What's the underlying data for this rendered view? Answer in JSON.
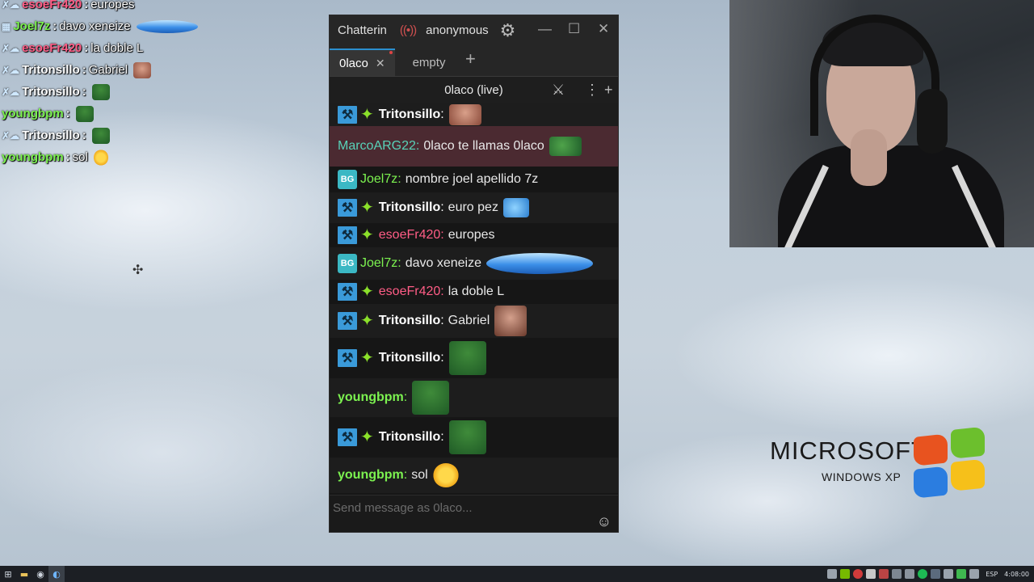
{
  "overlay_chat": [
    {
      "badges": true,
      "user": "esoeFr420",
      "color": "#ff5d86",
      "message": "europes",
      "emote": null
    },
    {
      "badges": false,
      "sub": true,
      "user": "Joel7z",
      "color": "#7cf250",
      "message": "davo xeneize",
      "emote": "ufo"
    },
    {
      "badges": true,
      "user": "esoeFr420",
      "color": "#ff5d86",
      "message": "la doble L",
      "emote": null
    },
    {
      "badges": true,
      "user": "Tritonsillo",
      "color": "#ffffff",
      "message": "Gabriel",
      "emote": "face"
    },
    {
      "badges": true,
      "user": "Tritonsillo",
      "color": "#ffffff",
      "message": "",
      "emote": "frog"
    },
    {
      "badges": false,
      "user": "youngbpm",
      "color": "#7cf250",
      "message": "",
      "emote": "frog"
    },
    {
      "badges": true,
      "user": "Tritonsillo",
      "color": "#ffffff",
      "message": "",
      "emote": "frog"
    },
    {
      "badges": false,
      "user": "youngbpm",
      "color": "#7cf250",
      "message": "sol",
      "emote": "sun"
    }
  ],
  "window": {
    "app_title": "Chatterin",
    "account": "anonymous",
    "tabs": [
      {
        "label": "0laco",
        "active": true
      },
      {
        "label": "empty",
        "active": false
      }
    ],
    "channel_title": "0laco (live)",
    "input_placeholder": "Send message as 0laco..."
  },
  "messages": [
    {
      "badges": "modvip",
      "user": "Tritonsillo",
      "color": "#ffffff",
      "bold": true,
      "text": "",
      "emote": "face",
      "height": 28,
      "style": "alt"
    },
    {
      "badges": "none",
      "user": "MarcoARG22",
      "color": "#58d2b8",
      "bold": false,
      "text": "0laco te llamas 0laco",
      "emote": "pepe-question",
      "height": 50,
      "style": "highlight"
    },
    {
      "badges": "sub",
      "user": "Joel7z",
      "color": "#7cf250",
      "bold": false,
      "text": "nombre joel apellido 7z",
      "emote": null,
      "height": 32,
      "style": ""
    },
    {
      "badges": "modvip",
      "user": "Tritonsillo",
      "color": "#ffffff",
      "bold": true,
      "text": "euro pez",
      "emote": "fish",
      "height": 38,
      "style": "alt"
    },
    {
      "badges": "modvip",
      "user": "esoeFr420",
      "color": "#ff5d86",
      "bold": false,
      "text": "europes",
      "emote": null,
      "height": 30,
      "style": ""
    },
    {
      "badges": "sub",
      "user": "Joel7z",
      "color": "#7cf250",
      "bold": false,
      "text": "davo xeneize",
      "emote": "ufo",
      "height": 40,
      "style": "alt"
    },
    {
      "badges": "modvip",
      "user": "esoeFr420",
      "color": "#ff5d86",
      "bold": false,
      "text": "la doble L",
      "emote": null,
      "height": 30,
      "style": ""
    },
    {
      "badges": "modvip",
      "user": "Tritonsillo",
      "color": "#ffffff",
      "bold": true,
      "text": "Gabriel",
      "emote": "face-big",
      "height": 42,
      "style": "alt"
    },
    {
      "badges": "modvip",
      "user": "Tritonsillo",
      "color": "#ffffff",
      "bold": true,
      "text": "",
      "emote": "frog",
      "height": 50,
      "style": ""
    },
    {
      "badges": "none",
      "user": "youngbpm",
      "color": "#7cf250",
      "bold": true,
      "text": "",
      "emote": "frog",
      "height": 48,
      "style": "alt"
    },
    {
      "badges": "modvip",
      "user": "Tritonsillo",
      "color": "#ffffff",
      "bold": true,
      "text": "",
      "emote": "frog",
      "height": 50,
      "style": ""
    },
    {
      "badges": "none",
      "user": "youngbpm",
      "color": "#7cf250",
      "bold": true,
      "text": "sol",
      "emote": "sun",
      "height": 44,
      "style": "alt"
    }
  ],
  "desktop": {
    "brand": "MICROSOFT",
    "product": "WINDOWS XP"
  },
  "taskbar": {
    "language": "ESP",
    "clock": "4:08:00"
  }
}
